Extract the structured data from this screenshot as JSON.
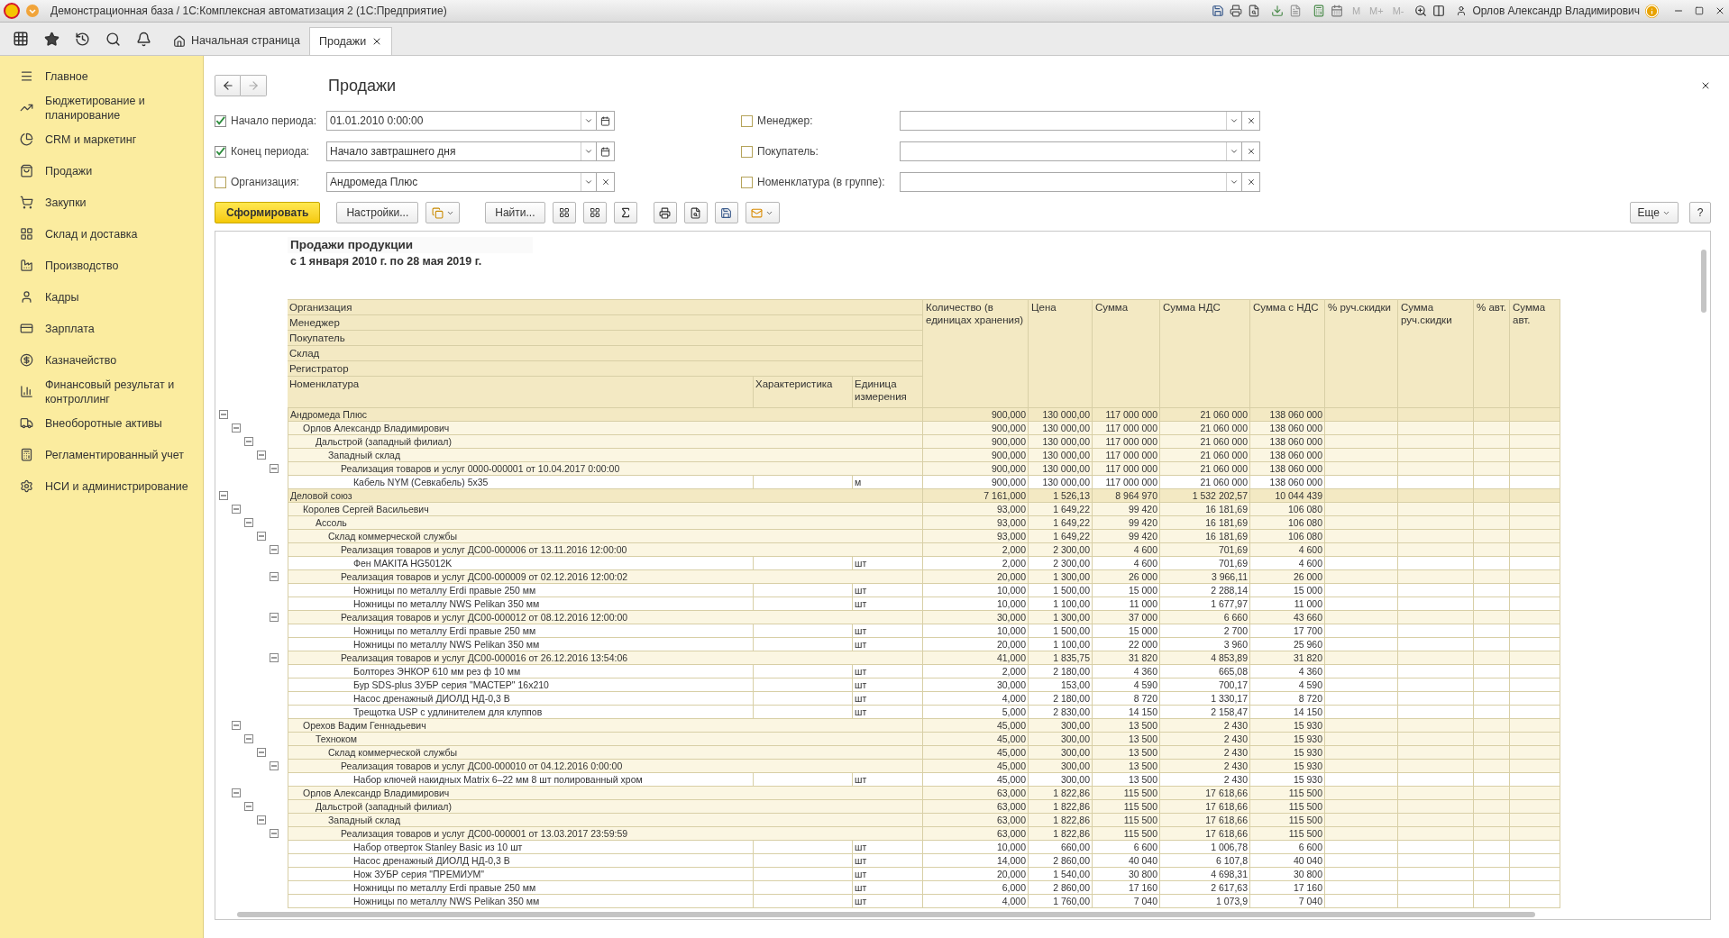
{
  "window": {
    "title": "Демонстрационная база / 1С:Комплексная автоматизация 2  (1С:Предприятие)",
    "memory_buttons": [
      "M",
      "M+",
      "M-"
    ],
    "user": "Орлов Александр Владимирович"
  },
  "tabs": [
    {
      "label": "Начальная страница",
      "kind": "home",
      "selected": false
    },
    {
      "label": "Продажи",
      "kind": "doc",
      "selected": true
    }
  ],
  "sidebar": {
    "items": [
      {
        "label": "Главное"
      },
      {
        "label": "Бюджетирование и планирование"
      },
      {
        "label": "CRM и маркетинг"
      },
      {
        "label": "Продажи"
      },
      {
        "label": "Закупки"
      },
      {
        "label": "Склад и доставка"
      },
      {
        "label": "Производство"
      },
      {
        "label": "Кадры"
      },
      {
        "label": "Зарплата"
      },
      {
        "label": "Казначейство"
      },
      {
        "label": "Финансовый результат и контроллинг"
      },
      {
        "label": "Внеоборотные активы"
      },
      {
        "label": "Регламентированный учет"
      },
      {
        "label": "НСИ и администрирование"
      }
    ]
  },
  "form": {
    "title": "Продажи",
    "filters_left": [
      {
        "label": "Начало периода:",
        "checked": true,
        "value": "01.01.2010  0:00:00",
        "kind": "date"
      },
      {
        "label": "Конец периода:",
        "checked": true,
        "value": "Начало завтрашнего дня",
        "kind": "date"
      },
      {
        "label": "Организация:",
        "checked": false,
        "value": "Андромеда Плюс",
        "kind": "choice"
      }
    ],
    "filters_right": [
      {
        "label": "Менеджер:",
        "checked": false,
        "kind": "choice"
      },
      {
        "label": "Покупатель:",
        "checked": false,
        "kind": "choice"
      },
      {
        "label": "Номенклатура (в группе):",
        "checked": false,
        "kind": "choice"
      }
    ],
    "toolbar": {
      "generate": "Сформировать",
      "settings": "Настройки...",
      "find": "Найти...",
      "more": "Еще",
      "help": "?"
    }
  },
  "report": {
    "title": "Продажи продукции",
    "subtitle": "с 1 января 2010 г. по 28 мая 2019 г.",
    "group_headers": [
      "Организация",
      "Менеджер",
      "Покупатель",
      "Склад",
      "Регистратор"
    ],
    "item_headers": [
      "Номенклатура",
      "Характеристика",
      "Единица измерения"
    ],
    "columns": [
      "Количество (в единицах хранения)",
      "Цена",
      "Сумма",
      "Сумма НДС",
      "Сумма с НДС",
      "% руч.скидки",
      "Сумма руч.скидки",
      "% авт.",
      "Сумма авт."
    ],
    "rows": [
      {
        "name": "Андромеда Плюс",
        "values": [
          "900,000",
          "130 000,00",
          "117 000 000",
          "21 060 000",
          "138 060 000"
        ],
        "expanded": true,
        "children": [
          {
            "name": "Орлов Александр Владимирович",
            "values": [
              "900,000",
              "130 000,00",
              "117 000 000",
              "21 060 000",
              "138 060 000"
            ],
            "expanded": true,
            "children": [
              {
                "name": "Дальстрой (западный филиал)",
                "values": [
                  "900,000",
                  "130 000,00",
                  "117 000 000",
                  "21 060 000",
                  "138 060 000"
                ],
                "expanded": true,
                "children": [
                  {
                    "name": "Западный склад",
                    "values": [
                      "900,000",
                      "130 000,00",
                      "117 000 000",
                      "21 060 000",
                      "138 060 000"
                    ],
                    "expanded": true,
                    "children": [
                      {
                        "name": "Реализация товаров и услуг 0000-000001 от 10.04.2017 0:00:00",
                        "values": [
                          "900,000",
                          "130 000,00",
                          "117 000 000",
                          "21 060 000",
                          "138 060 000"
                        ],
                        "expanded": true,
                        "children": [
                          {
                            "name": "Кабель NYM (Севкабель) 5x35",
                            "unit": "м",
                            "values": [
                              "900,000",
                              "130 000,00",
                              "117 000 000",
                              "21 060 000",
                              "138 060 000"
                            ]
                          }
                        ]
                      }
                    ]
                  }
                ]
              }
            ]
          }
        ]
      },
      {
        "name": "Деловой союз",
        "values": [
          "7 161,000",
          "1 526,13",
          "8 964 970",
          "1 532 202,57",
          "10 044 439"
        ],
        "expanded": true,
        "children": [
          {
            "name": "Королев Сергей Васильевич",
            "values": [
              "93,000",
              "1 649,22",
              "99 420",
              "16 181,69",
              "106 080"
            ],
            "expanded": true,
            "children": [
              {
                "name": "Ассоль",
                "values": [
                  "93,000",
                  "1 649,22",
                  "99 420",
                  "16 181,69",
                  "106 080"
                ],
                "expanded": true,
                "children": [
                  {
                    "name": "Склад коммерческой службы",
                    "values": [
                      "93,000",
                      "1 649,22",
                      "99 420",
                      "16 181,69",
                      "106 080"
                    ],
                    "expanded": true,
                    "children": [
                      {
                        "name": "Реализация товаров и услуг ДС00-000006 от 13.11.2016 12:00:00",
                        "values": [
                          "2,000",
                          "2 300,00",
                          "4 600",
                          "701,69",
                          "4 600"
                        ],
                        "expanded": true,
                        "children": [
                          {
                            "name": "Фен MAKITA HG5012K",
                            "unit": "шт",
                            "values": [
                              "2,000",
                              "2 300,00",
                              "4 600",
                              "701,69",
                              "4 600"
                            ]
                          }
                        ]
                      },
                      {
                        "name": "Реализация товаров и услуг ДС00-000009 от 02.12.2016 12:00:02",
                        "values": [
                          "20,000",
                          "1 300,00",
                          "26 000",
                          "3 966,11",
                          "26 000"
                        ],
                        "expanded": true,
                        "children": [
                          {
                            "name": "Ножницы по металлу Erdi правые 250 мм",
                            "unit": "шт",
                            "values": [
                              "10,000",
                              "1 500,00",
                              "15 000",
                              "2 288,14",
                              "15 000"
                            ]
                          },
                          {
                            "name": "Ножницы по металлу NWS Pelikan 350 мм",
                            "unit": "шт",
                            "values": [
                              "10,000",
                              "1 100,00",
                              "11 000",
                              "1 677,97",
                              "11 000"
                            ]
                          }
                        ]
                      },
                      {
                        "name": "Реализация товаров и услуг ДС00-000012 от 08.12.2016 12:00:00",
                        "values": [
                          "30,000",
                          "1 300,00",
                          "37 000",
                          "6 660",
                          "43 660"
                        ],
                        "expanded": true,
                        "children": [
                          {
                            "name": "Ножницы по металлу Erdi правые 250 мм",
                            "unit": "шт",
                            "values": [
                              "10,000",
                              "1 500,00",
                              "15 000",
                              "2 700",
                              "17 700"
                            ]
                          },
                          {
                            "name": "Ножницы по металлу NWS Pelikan 350 мм",
                            "unit": "шт",
                            "values": [
                              "20,000",
                              "1 100,00",
                              "22 000",
                              "3 960",
                              "25 960"
                            ]
                          }
                        ]
                      },
                      {
                        "name": "Реализация товаров и услуг ДС00-000016 от 26.12.2016 13:54:06",
                        "values": [
                          "41,000",
                          "1 835,75",
                          "31 820",
                          "4 853,89",
                          "31 820"
                        ],
                        "expanded": true,
                        "children": [
                          {
                            "name": "Болторез ЭНКОР 610 мм рез ф 10 мм",
                            "unit": "шт",
                            "values": [
                              "2,000",
                              "2 180,00",
                              "4 360",
                              "665,08",
                              "4 360"
                            ]
                          },
                          {
                            "name": "Бур SDS-plus ЗУБР серия \"МАСТЕР\" 16x210",
                            "unit": "шт",
                            "values": [
                              "30,000",
                              "153,00",
                              "4 590",
                              "700,17",
                              "4 590"
                            ]
                          },
                          {
                            "name": "Насос дренажный ДИОЛД НД-0,3 В",
                            "unit": "шт",
                            "values": [
                              "4,000",
                              "2 180,00",
                              "8 720",
                              "1 330,17",
                              "8 720"
                            ]
                          },
                          {
                            "name": "Трещотка USP с удлинителем для клуппов",
                            "unit": "шт",
                            "values": [
                              "5,000",
                              "2 830,00",
                              "14 150",
                              "2 158,47",
                              "14 150"
                            ]
                          }
                        ]
                      }
                    ]
                  }
                ]
              }
            ]
          },
          {
            "name": "Орехов Вадим Геннадьевич",
            "values": [
              "45,000",
              "300,00",
              "13 500",
              "2 430",
              "15 930"
            ],
            "expanded": true,
            "children": [
              {
                "name": "Техноком",
                "values": [
                  "45,000",
                  "300,00",
                  "13 500",
                  "2 430",
                  "15 930"
                ],
                "expanded": true,
                "children": [
                  {
                    "name": "Склад коммерческой службы",
                    "values": [
                      "45,000",
                      "300,00",
                      "13 500",
                      "2 430",
                      "15 930"
                    ],
                    "expanded": true,
                    "children": [
                      {
                        "name": "Реализация товаров и услуг ДС00-000010 от 04.12.2016 0:00:00",
                        "values": [
                          "45,000",
                          "300,00",
                          "13 500",
                          "2 430",
                          "15 930"
                        ],
                        "expanded": true,
                        "children": [
                          {
                            "name": "Набор ключей накидных Matrix 6–22 мм 8 шт полированный хром",
                            "unit": "шт",
                            "values": [
                              "45,000",
                              "300,00",
                              "13 500",
                              "2 430",
                              "15 930"
                            ]
                          }
                        ]
                      }
                    ]
                  }
                ]
              }
            ]
          },
          {
            "name": "Орлов Александр Владимирович",
            "values": [
              "63,000",
              "1 822,86",
              "115 500",
              "17 618,66",
              "115 500"
            ],
            "expanded": true,
            "children": [
              {
                "name": "Дальстрой (западный филиал)",
                "values": [
                  "63,000",
                  "1 822,86",
                  "115 500",
                  "17 618,66",
                  "115 500"
                ],
                "expanded": true,
                "children": [
                  {
                    "name": "Западный склад",
                    "values": [
                      "63,000",
                      "1 822,86",
                      "115 500",
                      "17 618,66",
                      "115 500"
                    ],
                    "expanded": true,
                    "children": [
                      {
                        "name": "Реализация товаров и услуг ДС00-000001 от 13.03.2017 23:59:59",
                        "values": [
                          "63,000",
                          "1 822,86",
                          "115 500",
                          "17 618,66",
                          "115 500"
                        ],
                        "expanded": true,
                        "children": [
                          {
                            "name": "Набор отверток Stanley Basic из 10 шт",
                            "unit": "шт",
                            "values": [
                              "10,000",
                              "660,00",
                              "6 600",
                              "1 006,78",
                              "6 600"
                            ]
                          },
                          {
                            "name": "Насос дренажный ДИОЛД НД-0,3 В",
                            "unit": "шт",
                            "values": [
                              "14,000",
                              "2 860,00",
                              "40 040",
                              "6 107,8",
                              "40 040"
                            ]
                          },
                          {
                            "name": "Нож ЗУБР серия \"ПРЕМИУМ\"",
                            "unit": "шт",
                            "values": [
                              "20,000",
                              "1 540,00",
                              "30 800",
                              "4 698,31",
                              "30 800"
                            ]
                          },
                          {
                            "name": "Ножницы по металлу Erdi правые 250 мм",
                            "unit": "шт",
                            "values": [
                              "6,000",
                              "2 860,00",
                              "17 160",
                              "2 617,63",
                              "17 160"
                            ]
                          },
                          {
                            "name": "Ножницы по металлу NWS Pelikan 350 мм",
                            "unit": "шт",
                            "values": [
                              "4,000",
                              "1 760,00",
                              "7 040",
                              "1 073,9",
                              "7 040"
                            ]
                          }
                        ]
                      }
                    ]
                  }
                ]
              }
            ]
          }
        ]
      }
    ]
  }
}
